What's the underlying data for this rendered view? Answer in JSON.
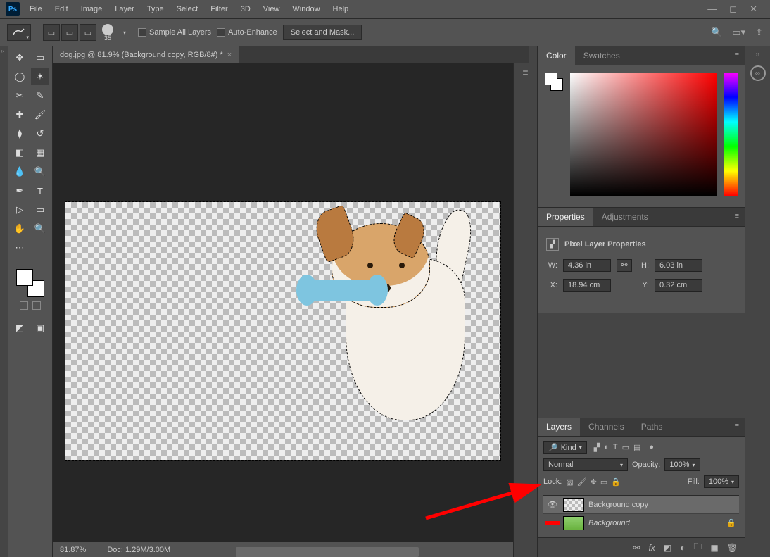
{
  "menu": {
    "items": [
      "File",
      "Edit",
      "Image",
      "Layer",
      "Type",
      "Select",
      "Filter",
      "3D",
      "View",
      "Window",
      "Help"
    ]
  },
  "options": {
    "brush_size": "35",
    "sample_all": "Sample All Layers",
    "auto_enhance": "Auto-Enhance",
    "select_mask": "Select and Mask..."
  },
  "filetab": {
    "label": "dog.jpg @ 81.9% (Background copy, RGB/8#) *"
  },
  "status": {
    "zoom": "81.87%",
    "doc": "Doc: 1.29M/3.00M"
  },
  "panels": {
    "color": {
      "tab1": "Color",
      "tab2": "Swatches"
    },
    "properties": {
      "tab1": "Properties",
      "tab2": "Adjustments",
      "title": "Pixel Layer Properties",
      "w_lab": "W:",
      "w_val": "4.36 in",
      "h_lab": "H:",
      "h_val": "6.03 in",
      "x_lab": "X:",
      "x_val": "18.94 cm",
      "y_lab": "Y:",
      "y_val": "0.32 cm"
    },
    "layers": {
      "tab1": "Layers",
      "tab2": "Channels",
      "tab3": "Paths",
      "filter": "Kind",
      "blend": "Normal",
      "opacity_lab": "Opacity:",
      "opacity_val": "100%",
      "lock_lab": "Lock:",
      "fill_lab": "Fill:",
      "fill_val": "100%",
      "layer1": "Background copy",
      "layer2": "Background"
    }
  }
}
